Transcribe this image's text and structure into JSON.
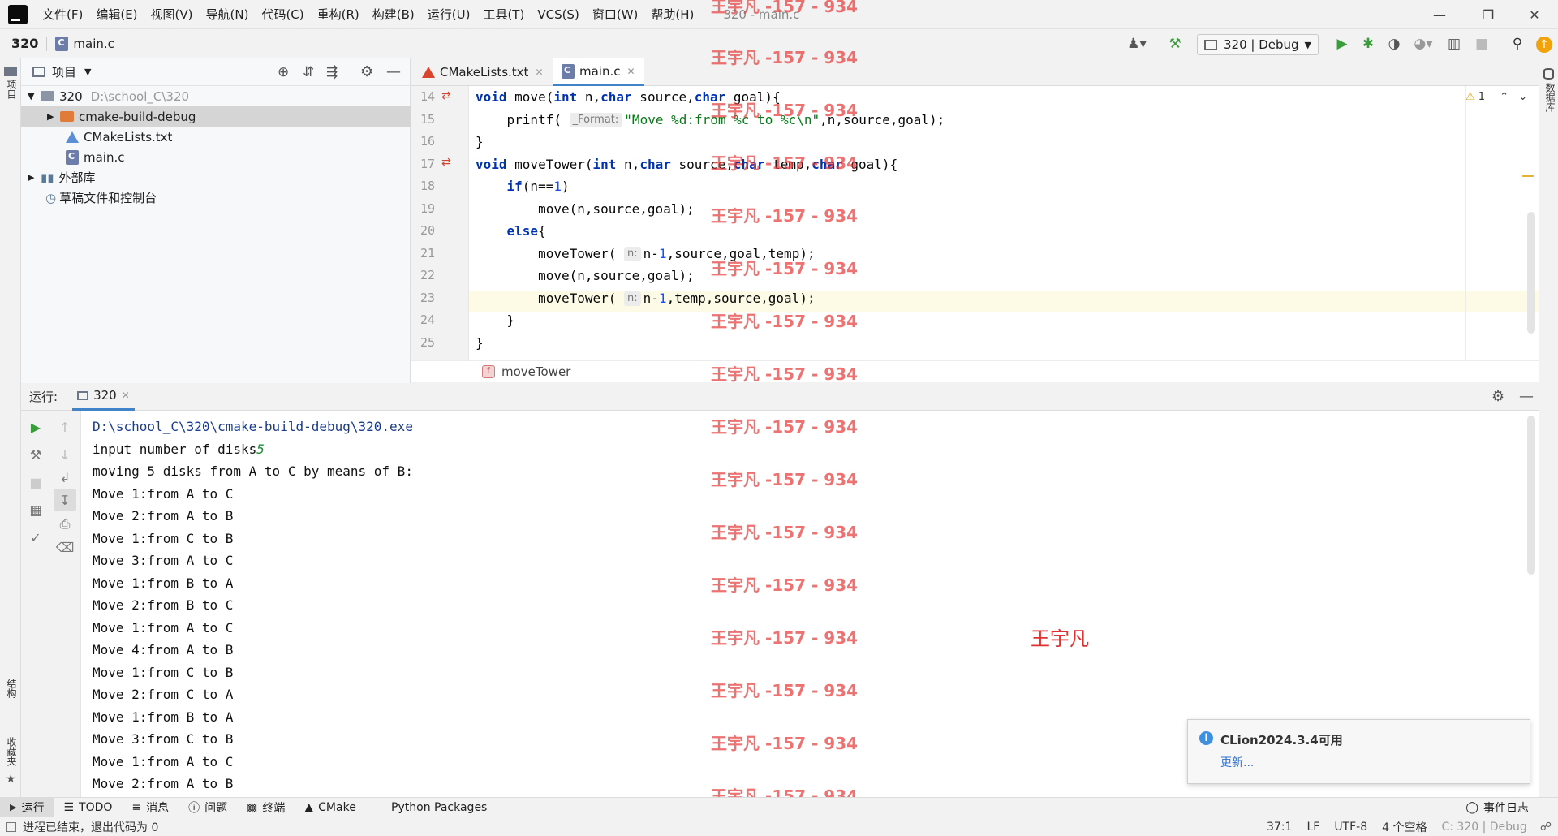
{
  "menubar": {
    "items": [
      "文件(F)",
      "编辑(E)",
      "视图(V)",
      "导航(N)",
      "代码(C)",
      "重构(R)",
      "构建(B)",
      "运行(U)",
      "工具(T)",
      "VCS(S)",
      "窗口(W)",
      "帮助(H)"
    ],
    "window_title": "320 - main.c"
  },
  "navbar": {
    "project": "320",
    "file": "main.c",
    "run_config": "320 | Debug"
  },
  "left_stripe": {
    "project_label": "项目",
    "structure_label": "结构",
    "favorites_label": "收藏夹"
  },
  "right_stripe": {
    "db_label": "数据库"
  },
  "project_panel": {
    "title": "项目",
    "tree": [
      {
        "name": "320",
        "path": "D:\\school_C\\320"
      },
      {
        "name": "cmake-build-debug"
      },
      {
        "name": "CMakeLists.txt"
      },
      {
        "name": "main.c"
      },
      {
        "name": "外部库"
      },
      {
        "name": "草稿文件和控制台"
      }
    ]
  },
  "editor": {
    "tabs": [
      "CMakeLists.txt",
      "main.c"
    ],
    "warning_count": "1",
    "lines": [
      {
        "n": "14"
      },
      {
        "n": "15"
      },
      {
        "n": "16"
      },
      {
        "n": "17"
      },
      {
        "n": "18"
      },
      {
        "n": "19"
      },
      {
        "n": "20"
      },
      {
        "n": "21"
      },
      {
        "n": "22"
      },
      {
        "n": "23"
      },
      {
        "n": "24"
      },
      {
        "n": "25"
      }
    ],
    "code": {
      "l14a": "void",
      "l14b": " move(",
      "l14c": "int",
      "l14d": " n,",
      "l14e": "char",
      "l14f": " source,",
      "l14g": "char",
      "l14h": " goal){",
      "l15a": "    printf( ",
      "l15hint": "_Format:",
      "l15b": "\"Move %d:from %c to %c\\n\"",
      "l15c": ",n,source,goal);",
      "l16": "}",
      "l17a": "void",
      "l17b": " moveTower(",
      "l17c": "int",
      "l17d": " n,",
      "l17e": "char",
      "l17f": " source,",
      "l17g": "char",
      "l17h": " temp,",
      "l17i": "char",
      "l17j": " goal){",
      "l18a": "    ",
      "l18b": "if",
      "l18c": "(n==",
      "l18d": "1",
      "l18e": ")",
      "l19": "        move(n,source,goal);",
      "l20a": "    ",
      "l20b": "else",
      "l20c": "{",
      "l21a": "        moveTower( ",
      "l21hint": "n:",
      "l21b": "n-",
      "l21c": "1",
      "l21d": ",source,goal,temp);",
      "l22": "        move(n,source,goal);",
      "l23a": "        moveTower( ",
      "l23hint": "n:",
      "l23b": "n-",
      "l23c": "1",
      "l23d": ",temp,source,goal);",
      "l24": "    }",
      "l25": "}"
    },
    "breadcrumb": "moveTower"
  },
  "run_panel": {
    "label": "运行:",
    "tab": "320",
    "output": {
      "exe_path": "D:\\school_C\\320\\cmake-build-debug\\320.exe",
      "prompt": "input number of disks",
      "input": "5",
      "lines": [
        "moving 5 disks from A to C by means of B:",
        "Move 1:from A to C",
        "Move 2:from A to B",
        "Move 1:from C to B",
        "Move 3:from A to C",
        "Move 1:from B to A",
        "Move 2:from B to C",
        "Move 1:from A to C",
        "Move 4:from A to B",
        "Move 1:from C to B",
        "Move 2:from C to A",
        "Move 1:from B to A",
        "Move 3:from C to B",
        "Move 1:from A to C",
        "Move 2:from A to B"
      ]
    }
  },
  "watermark": {
    "text": "王宇凡 -157 - 934",
    "name": "王宇凡"
  },
  "notification": {
    "title": "CLion2024.3.4可用",
    "link": "更新..."
  },
  "bottom_toolbar": [
    "运行",
    "TODO",
    "消息",
    "问题",
    "终端",
    "CMake",
    "Python Packages"
  ],
  "event_log": "事件日志",
  "status": {
    "left": "进程已结束，退出代码为 0",
    "position": "37:1",
    "line_sep": "LF",
    "encoding": "UTF-8",
    "indent": "4 个空格",
    "context": "C: 320 | Debug"
  }
}
